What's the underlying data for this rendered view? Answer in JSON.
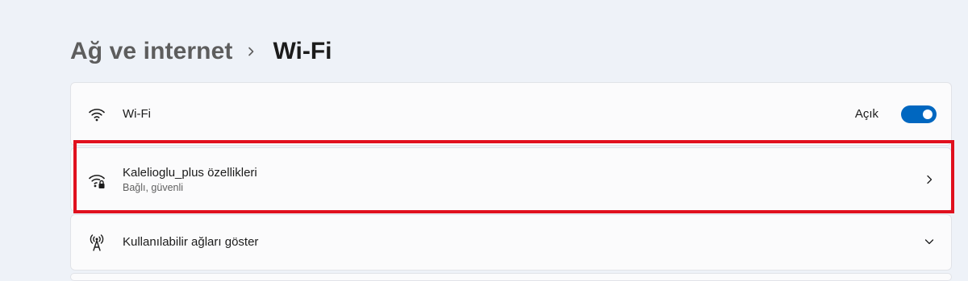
{
  "breadcrumb": {
    "parent": "Ağ ve internet",
    "separator_icon": "chevron-right-icon",
    "current": "Wi-Fi"
  },
  "wifi_row": {
    "icon": "wifi-icon",
    "title": "Wi-Fi",
    "state_label": "Açık",
    "toggle_on": true
  },
  "network_row": {
    "icon": "wifi-secured-icon",
    "title": "Kalelioglu_plus özellikleri",
    "subtitle": "Bağlı, güvenli",
    "action_icon": "chevron-right-icon"
  },
  "available_row": {
    "icon": "antenna-icon",
    "title": "Kullanılabilir ağları göster",
    "action_icon": "chevron-down-icon"
  },
  "colors": {
    "accent": "#0067c0",
    "highlight": "#e0101e",
    "background": "#eef2f8",
    "card": "#fbfbfc"
  }
}
